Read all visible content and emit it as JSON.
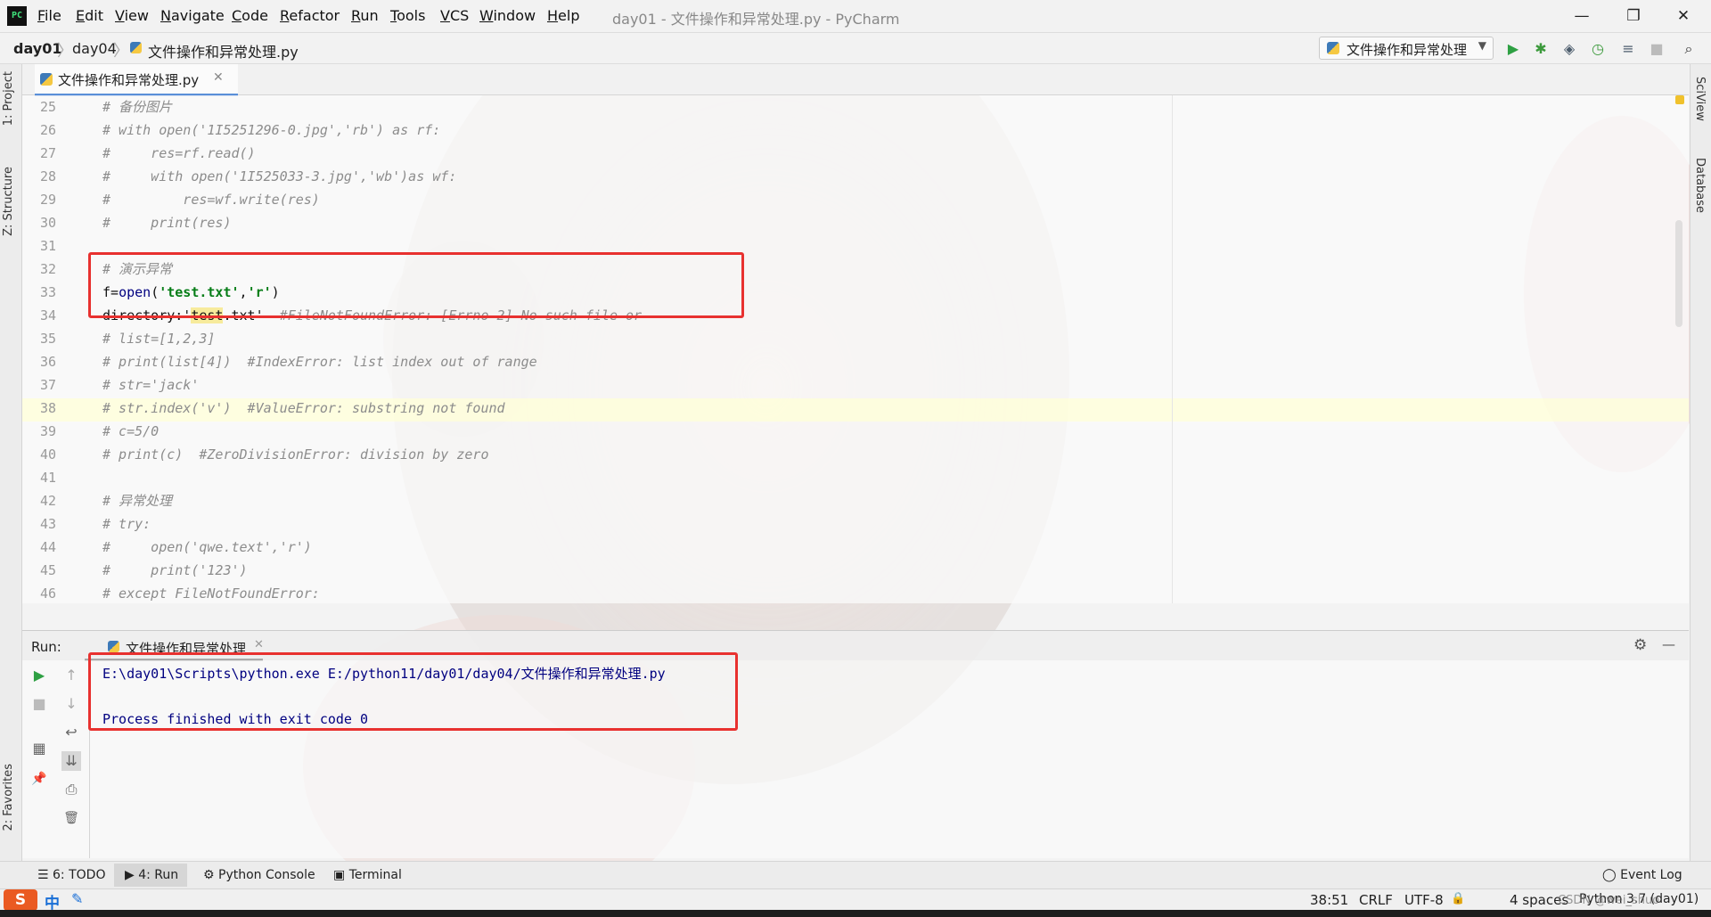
{
  "app": {
    "window_title": "day01 - 文件操作和异常处理.py - PyCharm",
    "logo_text": "PC"
  },
  "menu": [
    "File",
    "Edit",
    "View",
    "Navigate",
    "Code",
    "Refactor",
    "Run",
    "Tools",
    "VCS",
    "Window",
    "Help"
  ],
  "window_controls": {
    "minimize": "—",
    "restore": "❐",
    "close": "✕"
  },
  "breadcrumb": {
    "project": "day01",
    "folder": "day04",
    "file": "文件操作和异常处理.py",
    "sep": "〉"
  },
  "run_config": {
    "label": "文件操作和异常处理",
    "arrow": "▼"
  },
  "toolbar_icons": {
    "run": "▶",
    "debug": "✱",
    "coverage": "◈",
    "profile": "◷",
    "build": "≡",
    "stop": "■",
    "search": "⌕"
  },
  "left_tool_tabs": {
    "project": "1: Project",
    "structure": "Z: Structure",
    "favorites": "2: Favorites"
  },
  "right_tool_tabs": {
    "sciview": "SciView",
    "database": "Database"
  },
  "editor_tab": {
    "label": "文件操作和异常处理.py",
    "close": "✕"
  },
  "editor": {
    "lines": [
      {
        "n": "25",
        "text": "# 备份图片"
      },
      {
        "n": "26",
        "text": "# with open('1I5251296-0.jpg','rb') as rf:"
      },
      {
        "n": "27",
        "text": "#     res=rf.read()"
      },
      {
        "n": "28",
        "text": "#     with open('1I525033-3.jpg','wb')as wf:"
      },
      {
        "n": "29",
        "text": "#         res=wf.write(res)"
      },
      {
        "n": "30",
        "text": "#     print(res)"
      },
      {
        "n": "31",
        "text": ""
      },
      {
        "n": "32",
        "text": "# 演示异常"
      },
      {
        "n": "33",
        "text": ""
      },
      {
        "n": "34",
        "text": ""
      },
      {
        "n": "35",
        "text": "# list=[1,2,3]"
      },
      {
        "n": "36",
        "text": "# print(list[4])  #IndexError: list index out of range"
      },
      {
        "n": "37",
        "text": "# str='jack'"
      },
      {
        "n": "38",
        "text": "# str.index('v')  #ValueError: substring not found"
      },
      {
        "n": "39",
        "text": "# c=5/0"
      },
      {
        "n": "40",
        "text": "# print(c)  #ZeroDivisionError: division by zero"
      },
      {
        "n": "41",
        "text": ""
      },
      {
        "n": "42",
        "text": "# 异常处理"
      },
      {
        "n": "43",
        "text": "# try:"
      },
      {
        "n": "44",
        "text": "#     open('qwe.text','r')"
      },
      {
        "n": "45",
        "text": "#     print('123')"
      },
      {
        "n": "46",
        "text": "# except FileNotFoundError:"
      }
    ],
    "line33": {
      "a": "f=",
      "b": "open",
      "c": "(",
      "d": "'test.txt'",
      "e": ",",
      "f": "'r'",
      "g": ")"
    },
    "line34": {
      "a": "directory:'",
      "b": "test",
      "c": ".txt'",
      "d": "  #FileNotFoundError: [Errno 2] No such file or"
    }
  },
  "run_panel": {
    "label": "Run:",
    "tab_label": "文件操作和异常处理",
    "tab_close": "✕",
    "settings_icon": "⚙",
    "hide_icon": "—",
    "console": [
      "E:\\day01\\Scripts\\python.exe E:/python11/day01/day04/文件操作和异常处理.py",
      "",
      "Process finished with exit code 0"
    ],
    "side_icons": {
      "rerun": "▶",
      "stop": "■",
      "up": "↑",
      "down": "↓",
      "wrap": "↩",
      "scroll_end": "⇊",
      "layout": "▦",
      "print": "⎙",
      "pin": "📌",
      "trash": "🗑"
    }
  },
  "bottom_tabs": [
    {
      "key": "todo",
      "icon": "☰",
      "label": "6: TODO"
    },
    {
      "key": "run",
      "icon": "▶",
      "label": "4: Run"
    },
    {
      "key": "pyconsole",
      "icon": "⚙",
      "label": "Python Console"
    },
    {
      "key": "terminal",
      "icon": "▣",
      "label": "Terminal"
    }
  ],
  "event_log": {
    "icon": "◯",
    "label": "Event Log"
  },
  "status_bar": {
    "position": "38:51",
    "line_sep": "CRLF",
    "encoding": "UTF-8",
    "lock": "🔒",
    "indent": "4 spaces",
    "interpreter": "Python 3.7 (day01)",
    "watermark": "CSDN @wei_shuo"
  },
  "ime": {
    "logo": "S",
    "mode": "中",
    "pen": "✎"
  },
  "colors": {
    "accent": "#5a8fd8",
    "highlight_box": "#e8312f",
    "console_text": "#000080",
    "string": "#067d17"
  }
}
